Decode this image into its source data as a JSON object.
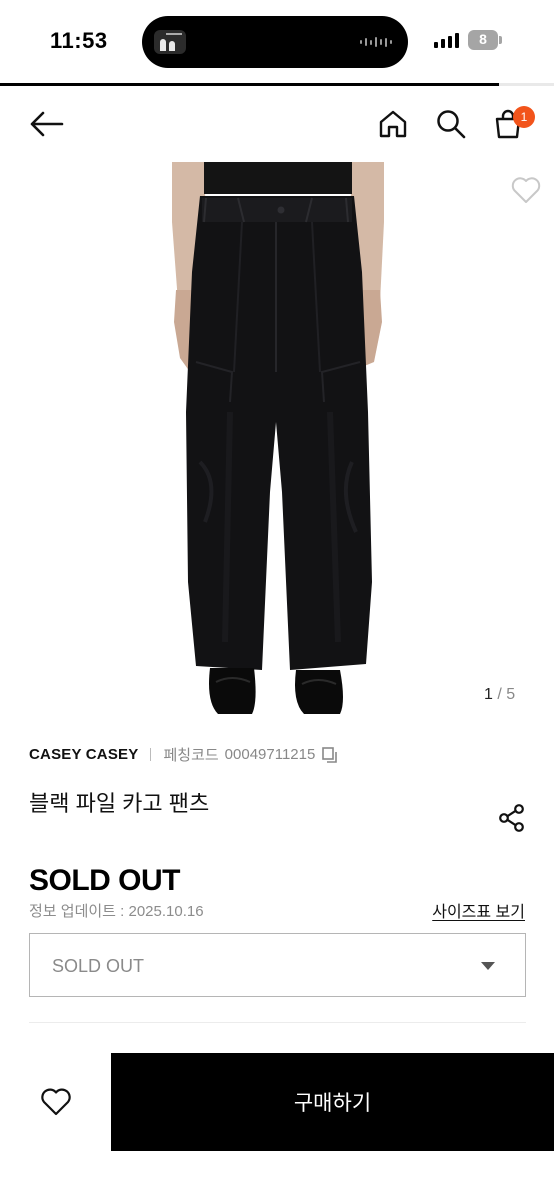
{
  "status_bar": {
    "time": "11:53",
    "battery": "8"
  },
  "nav": {
    "cart_count": "1"
  },
  "gallery": {
    "current": "1",
    "separator": "/",
    "total": "5"
  },
  "product": {
    "brand": "CASEY CASEY",
    "code_label": "페칭코드",
    "code_value": "00049711215",
    "name": "블랙 파일 카고 팬츠",
    "price": "SOLD OUT",
    "update_info": "정보 업데이트 : 2025.10.16",
    "size_chart_label": "사이즈표 보기"
  },
  "option": {
    "selected": "SOLD OUT"
  },
  "actions": {
    "buy_label": "구매하기"
  },
  "colors": {
    "accent": "#f2541b",
    "primary": "#000000"
  },
  "icons": [
    "back-arrow-icon",
    "home-icon",
    "search-icon",
    "shopping-bag-icon",
    "heart-icon",
    "copy-icon",
    "share-icon",
    "chevron-down-icon"
  ]
}
